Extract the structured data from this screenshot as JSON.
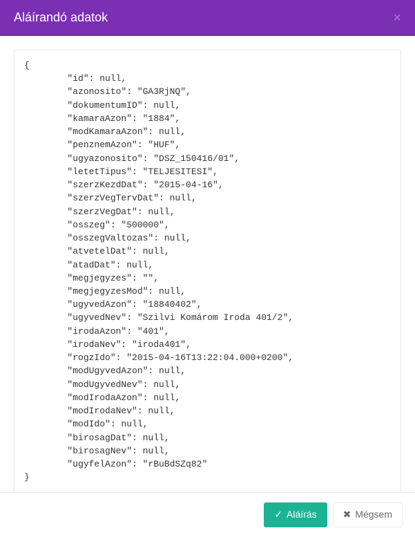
{
  "header": {
    "title": "Aláírandó adatok"
  },
  "body": {
    "json_text": "{\n        \"id\": null,\n        \"azonosito\": \"GA3RjNQ\",\n        \"dokumentumID\": null,\n        \"kamaraAzon\": \"1884\",\n        \"modKamaraAzon\": null,\n        \"penznemAzon\": \"HUF\",\n        \"ugyazonosito\": \"DSZ_150416/01\",\n        \"letetTipus\": \"TELJESITESI\",\n        \"szerzKezdDat\": \"2015-04-16\",\n        \"szerzVegTervDat\": null,\n        \"szerzVegDat\": null,\n        \"osszeg\": \"500000\",\n        \"osszegValtozas\": null,\n        \"atvetelDat\": null,\n        \"atadDat\": null,\n        \"megjegyzes\": \"\",\n        \"megjegyzesMod\": null,\n        \"ugyvedAzon\": \"18840402\",\n        \"ugyvedNev\": \"Szilvi Komárom Iroda 401/2\",\n        \"irodaAzon\": \"401\",\n        \"irodaNev\": \"iroda401\",\n        \"rogzIdo\": \"2015-04-16T13:22:04.000+0200\",\n        \"modUgyvedAzon\": null,\n        \"modUgyvedNev\": null,\n        \"modIrodaAzon\": null,\n        \"modIrodaNev\": null,\n        \"modIdo\": null,\n        \"birosagDat\": null,\n        \"birosagNev\": null,\n        \"ugyfelAzon\": \"rBuBdSZq82\"\n}"
  },
  "footer": {
    "sign_label": "Aláírás",
    "cancel_label": "Mégsem",
    "check_glyph": "✓",
    "x_glyph": "✖"
  }
}
